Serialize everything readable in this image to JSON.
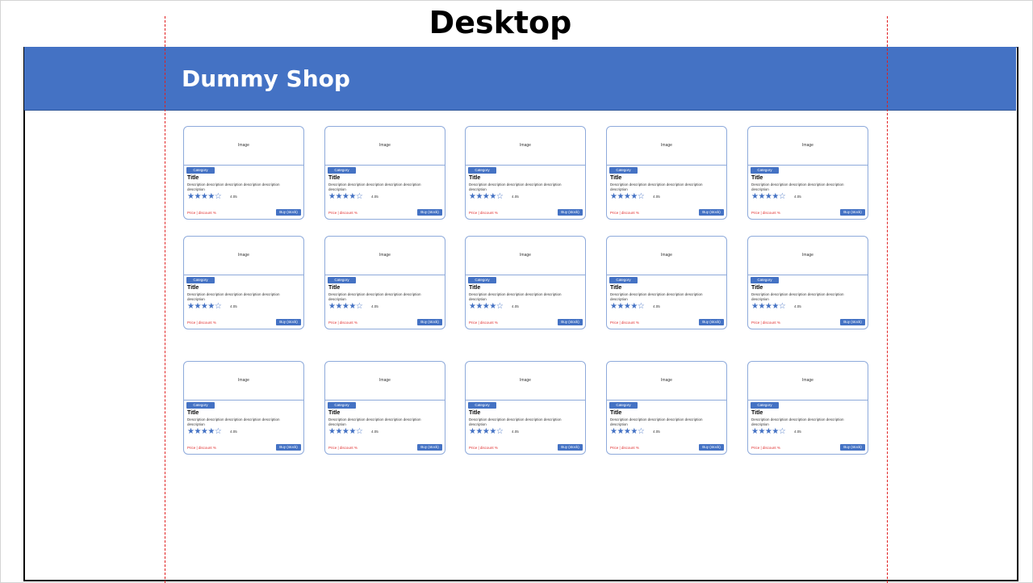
{
  "page": {
    "title": "Desktop"
  },
  "header": {
    "shop_name": "Dummy Shop",
    "background_color": "#4472c4"
  },
  "guides_color": "#e02020",
  "card_template": {
    "image_label": "Image",
    "category": "Category",
    "title": "Title",
    "description": "Description description description description description description",
    "stars_filled": 4,
    "stars_total": 5,
    "stars_text": "★★★★☆",
    "rating": "4.05",
    "price": "Price | discount %",
    "buy_label": "Buy (stock)"
  },
  "grid": {
    "rows": 3,
    "columns": 5
  }
}
